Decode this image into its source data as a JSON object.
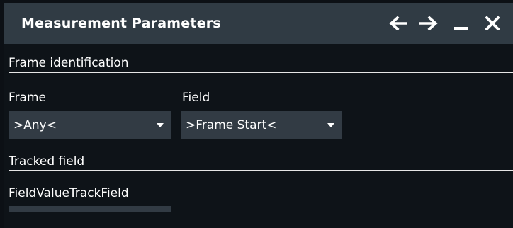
{
  "window": {
    "title": "Measurement Parameters",
    "controls": {
      "back_icon": "arrow-left",
      "forward_icon": "arrow-right",
      "minimize_icon": "minus",
      "close_icon": "x"
    }
  },
  "frame_identification": {
    "header": "Frame identification",
    "frame": {
      "label": "Frame",
      "value": ">Any<"
    },
    "field": {
      "label": "Field",
      "value": ">Frame Start<"
    }
  },
  "tracked_field": {
    "header": "Tracked field",
    "field_value_track_field": {
      "label": "FieldValueTrackField",
      "value": ""
    }
  },
  "colors": {
    "titlebar": "#303b44",
    "background": "#0e1318",
    "combo": "#323b44",
    "text": "#ffffff"
  }
}
